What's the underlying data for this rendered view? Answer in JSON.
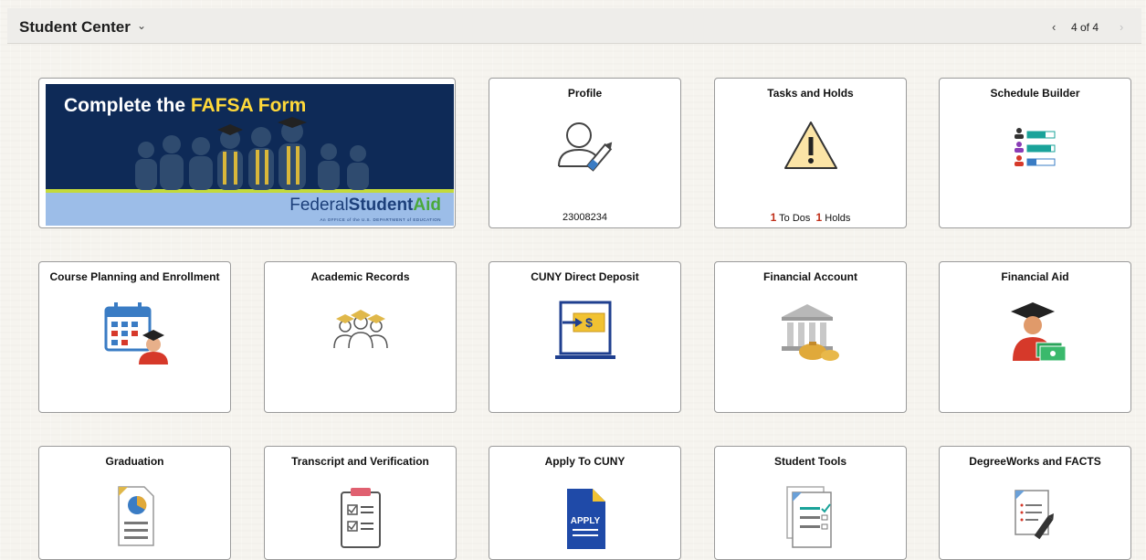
{
  "header": {
    "title": "Student Center",
    "pager": "4 of 4"
  },
  "banner": {
    "headline_prefix": "Complete the ",
    "headline_highlight": "FAFSA Form",
    "brand_federal": "Federal",
    "brand_student": "Student",
    "brand_aid": "Aid",
    "brand_sub": "An OFFICE of the U.S. DEPARTMENT of EDUCATION"
  },
  "tiles": {
    "profile": {
      "title": "Profile",
      "footer": "23008234"
    },
    "tasks": {
      "title": "Tasks and Holds",
      "todo_count": "1",
      "todo_label": "To Dos",
      "holds_count": "1",
      "holds_label": "Holds"
    },
    "schedule": {
      "title": "Schedule Builder"
    },
    "course": {
      "title": "Course Planning and Enrollment"
    },
    "academic": {
      "title": "Academic Records"
    },
    "deposit": {
      "title": "CUNY Direct Deposit"
    },
    "account": {
      "title": "Financial Account"
    },
    "aid": {
      "title": "Financial Aid"
    },
    "graduation": {
      "title": "Graduation"
    },
    "transcript": {
      "title": "Transcript and Verification"
    },
    "apply": {
      "title": "Apply To CUNY",
      "icon_label": "APPLY"
    },
    "tools": {
      "title": "Student Tools"
    },
    "degreeworks": {
      "title": "DegreeWorks and FACTS"
    }
  },
  "colors": {
    "accent_red": "#c0301a",
    "banner_navy": "#0e2a57",
    "fafsa_yellow": "#ffd93a"
  }
}
